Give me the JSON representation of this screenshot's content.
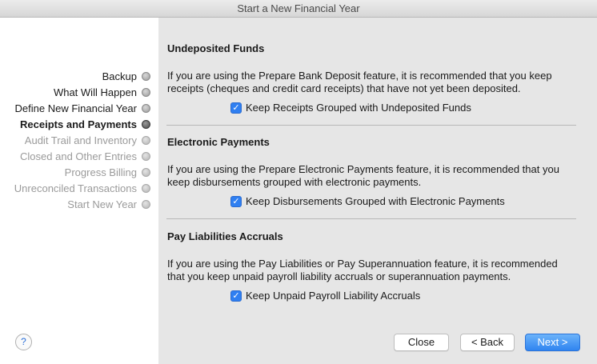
{
  "window": {
    "title": "Start a New Financial Year"
  },
  "sidebar": {
    "steps": [
      {
        "label": "Backup",
        "state": "done"
      },
      {
        "label": "What Will Happen",
        "state": "done"
      },
      {
        "label": "Define New Financial Year",
        "state": "done"
      },
      {
        "label": "Receipts and Payments",
        "state": "current"
      },
      {
        "label": "Audit Trail and Inventory",
        "state": "pending"
      },
      {
        "label": "Closed and Other Entries",
        "state": "pending"
      },
      {
        "label": "Progress Billing",
        "state": "pending"
      },
      {
        "label": "Unreconciled Transactions",
        "state": "pending"
      },
      {
        "label": "Start New Year",
        "state": "pending"
      }
    ],
    "help_label": "?"
  },
  "sections": [
    {
      "title": "Undeposited Funds",
      "description_lines": [
        "If you are using the Prepare Bank Deposit feature, it is recommended that you keep",
        "receipts (cheques and credit card receipts) that have not yet been deposited."
      ],
      "checkbox": {
        "label": "Keep Receipts Grouped with Undeposited Funds",
        "checked": true
      }
    },
    {
      "title": "Electronic Payments",
      "description_lines": [
        "If you are using the Prepare Electronic Payments feature, it is recommended that you",
        "keep disbursements grouped with electronic payments."
      ],
      "checkbox": {
        "label": "Keep Disbursements Grouped with Electronic Payments",
        "checked": true
      }
    },
    {
      "title": "Pay Liabilities Accruals",
      "description_lines": [
        "If you are using the Pay Liabilities or Pay Superannuation feature, it is recommended",
        "that you keep unpaid payroll liability accruals or superannuation payments."
      ],
      "checkbox": {
        "label": "Keep Unpaid Payroll Liability Accruals",
        "checked": true
      }
    }
  ],
  "buttons": {
    "close": "Close",
    "back": "< Back",
    "next": "Next >"
  },
  "colors": {
    "accent": "#2f7ff1",
    "sidebar_bg": "#ffffff",
    "panel_bg": "#e6e6e6"
  }
}
